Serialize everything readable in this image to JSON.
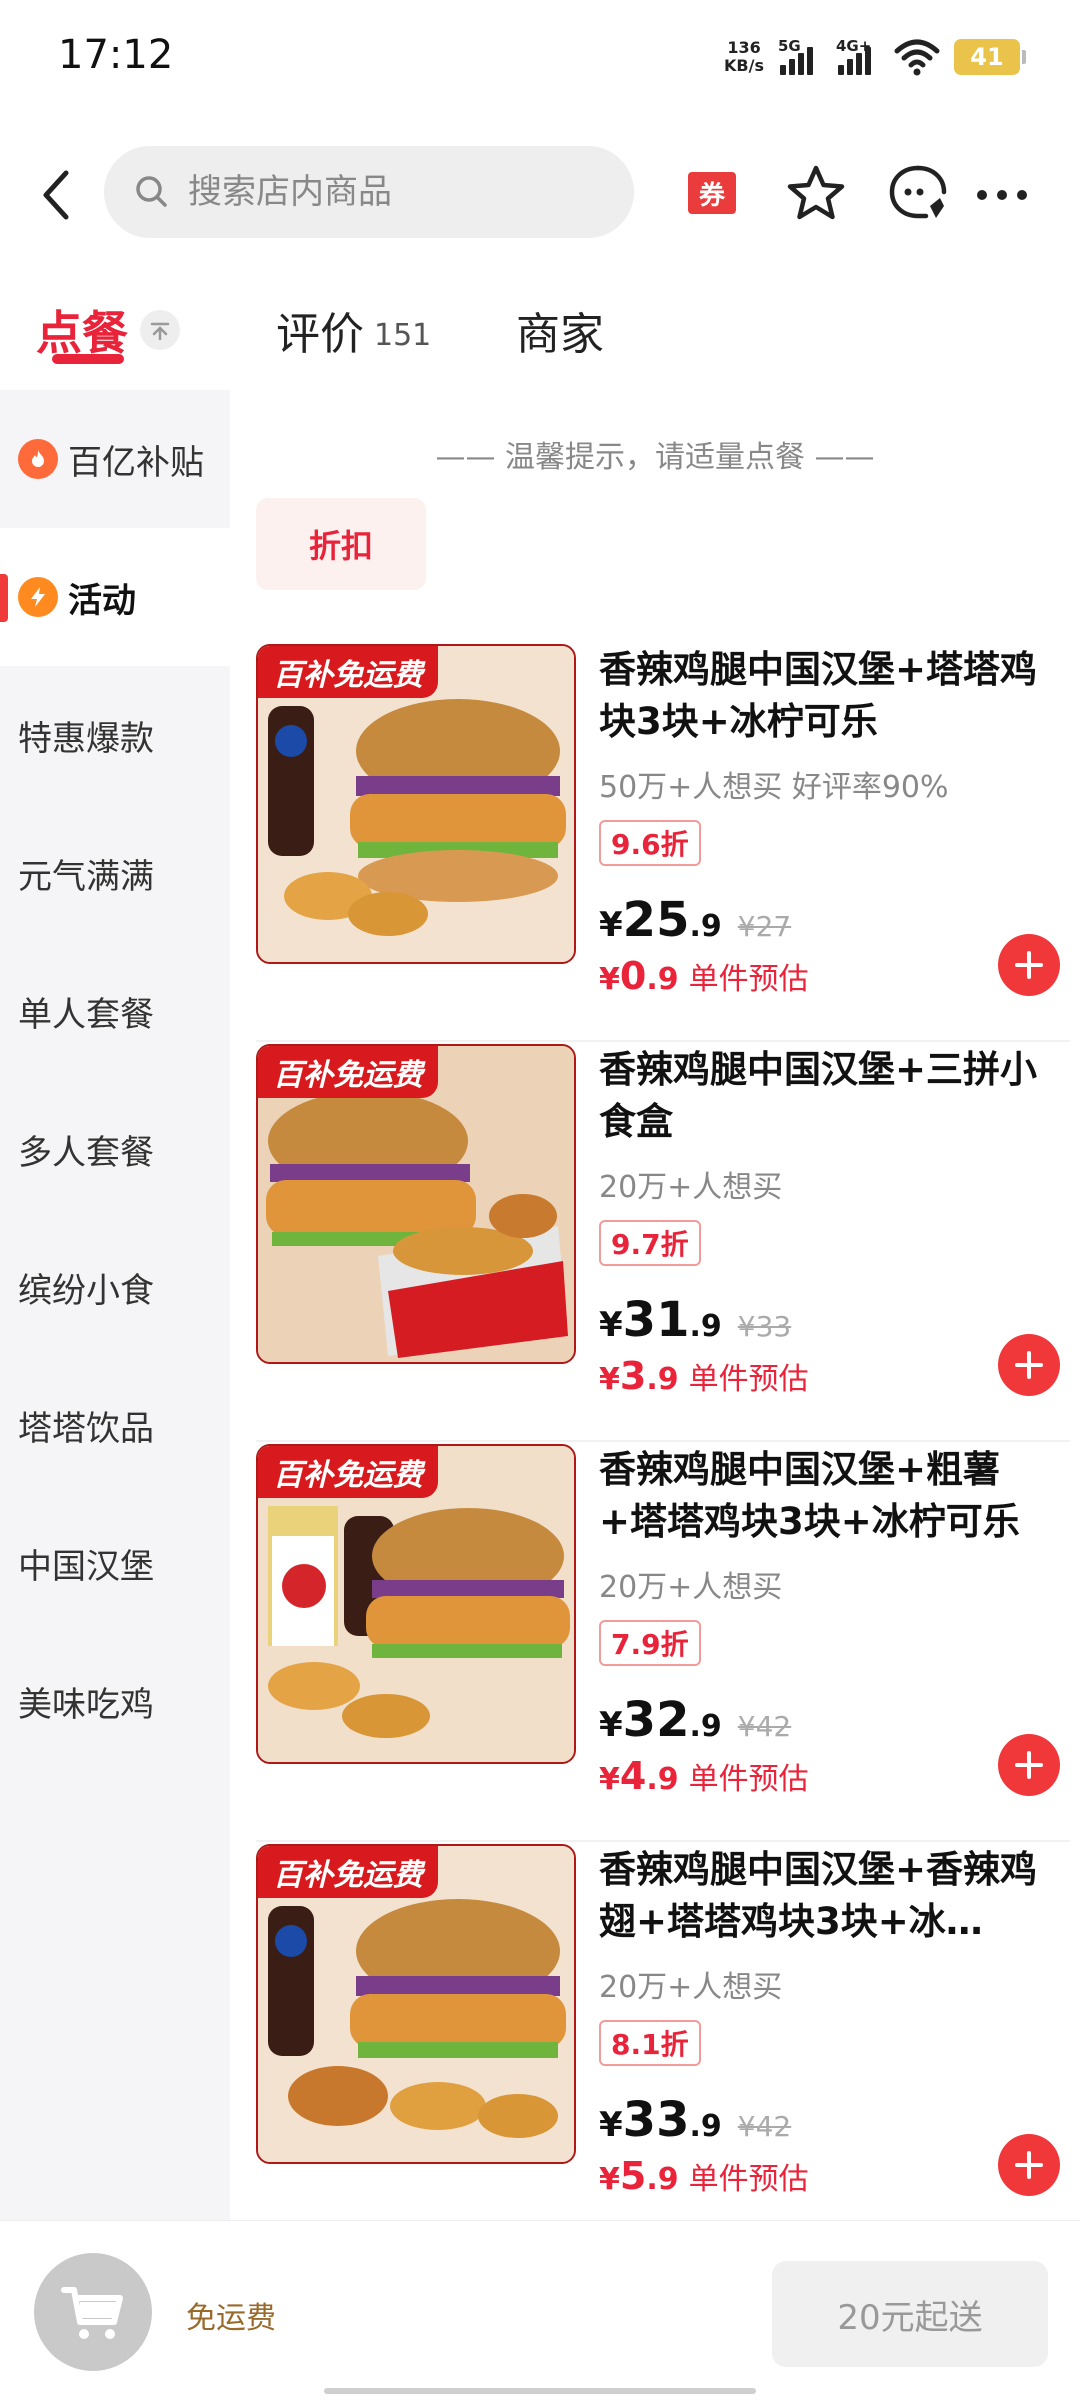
{
  "status_bar": {
    "time": "17:12",
    "net_speed_value": "136",
    "net_speed_unit": "KB/s",
    "signal_1": "5G",
    "signal_2": "4G+",
    "battery": "41"
  },
  "header": {
    "search_placeholder": "搜索店内商品",
    "coupon_label": "券"
  },
  "tabs": {
    "order": "点餐",
    "review": "评价",
    "review_count": "151",
    "merchant": "商家"
  },
  "sidebar": {
    "items": [
      {
        "label": "百亿补贴"
      },
      {
        "label": "活动"
      },
      {
        "label": "特惠爆款"
      },
      {
        "label": "元气满满"
      },
      {
        "label": "单人套餐"
      },
      {
        "label": "多人套餐"
      },
      {
        "label": "缤纷小食"
      },
      {
        "label": "塔塔饮品"
      },
      {
        "label": "中国汉堡"
      },
      {
        "label": "美味吃鸡"
      }
    ]
  },
  "main": {
    "tip": "—— 温馨提示，请适量点餐 ——",
    "discount_tag": "折扣",
    "image_badge": "百补免运费",
    "currency": "¥",
    "estimate_label": "单件预估",
    "products": [
      {
        "title": "香辣鸡腿中国汉堡+塔塔鸡块3块+冰柠可乐",
        "meta": "50万+人想买  好评率90%",
        "discount": "9.6折",
        "price_int": "25",
        "price_dec": ".9",
        "orig_price": "¥27",
        "est_int": "0",
        "est_dec": ".9"
      },
      {
        "title": "香辣鸡腿中国汉堡+三拼小食盒",
        "meta": "20万+人想买",
        "discount": "9.7折",
        "price_int": "31",
        "price_dec": ".9",
        "orig_price": "¥33",
        "est_int": "3",
        "est_dec": ".9"
      },
      {
        "title": "香辣鸡腿中国汉堡+粗薯+塔塔鸡块3块+冰柠可乐",
        "meta": "20万+人想买",
        "discount": "7.9折",
        "price_int": "32",
        "price_dec": ".9",
        "orig_price": "¥42",
        "est_int": "4",
        "est_dec": ".9"
      },
      {
        "title": "香辣鸡腿中国汉堡+香辣鸡翅+塔塔鸡块3块+冰…",
        "meta": "20万+人想买",
        "discount": "8.1折",
        "price_int": "33",
        "price_dec": ".9",
        "orig_price": "¥42",
        "est_int": "5",
        "est_dec": ".9"
      }
    ]
  },
  "bottom_bar": {
    "free_shipping": "免运费",
    "min_order": "20元起送"
  },
  "colors": {
    "accent_red": "#e8233a",
    "add_button": "#f0383a",
    "sidebar_bg": "#f5f5f7"
  }
}
